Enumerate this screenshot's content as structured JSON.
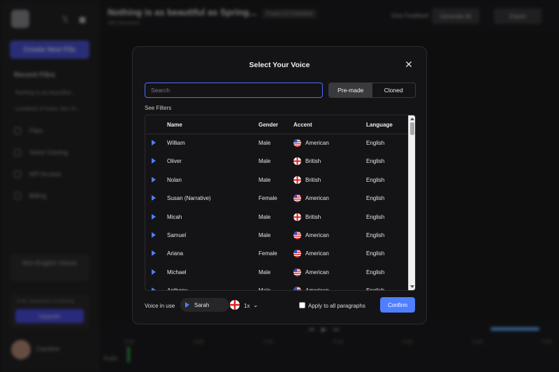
{
  "app": {
    "window_title": "Nothing is as beautiful as Spring...",
    "doc_badge": "Fixed (10 Editable)",
    "doc_sub": "185 characters",
    "create_button": "Create New File",
    "recent_files_label": "Recent Files",
    "recent_files": [
      "Nothing is as beautiful...",
      "Loveliest of trees, the ch..."
    ],
    "nav_items": [
      "Files",
      "Voice Cloning",
      "API Access",
      "Billing"
    ],
    "non_english": "Non-English Voices",
    "chars_remaining": "6.9K characters remaining",
    "upgrade_button": "Upgrade",
    "user_name": "Caroline",
    "feedback_link": "Give Feedback",
    "generate_button": "Generate All",
    "export_button": "Export",
    "timeline_ticks": [
      "0:00",
      "0:05",
      "0:10",
      "0:15",
      "0:20",
      "0:25",
      "0:30"
    ],
    "timeline_track": "Audio"
  },
  "modal": {
    "title": "Select Your Voice",
    "search_placeholder": "Search",
    "tabs": [
      {
        "label": "Pre-made",
        "active": true
      },
      {
        "label": "Cloned",
        "active": false
      }
    ],
    "see_filters": "See Filters",
    "columns": {
      "name": "Name",
      "gender": "Gender",
      "accent": "Accent",
      "language": "Language"
    },
    "voices": [
      {
        "name": "William",
        "gender": "Male",
        "accent": "American",
        "flag": "us-flag-icon",
        "language": "English"
      },
      {
        "name": "Oliver",
        "gender": "Male",
        "accent": "British",
        "flag": "uk-flag-icon",
        "language": "English"
      },
      {
        "name": "Nolan",
        "gender": "Male",
        "accent": "British",
        "flag": "uk-flag-icon",
        "language": "English"
      },
      {
        "name": "Susan (Narrative)",
        "gender": "Female",
        "accent": "American",
        "flag": "us-flag-icon",
        "language": "English"
      },
      {
        "name": "Micah",
        "gender": "Male",
        "accent": "British",
        "flag": "uk-flag-icon",
        "language": "English"
      },
      {
        "name": "Samuel",
        "gender": "Male",
        "accent": "American",
        "flag": "us-flag-icon",
        "language": "English"
      },
      {
        "name": "Ariana",
        "gender": "Female",
        "accent": "American",
        "flag": "us-flag-icon",
        "language": "English"
      },
      {
        "name": "Michael",
        "gender": "Male",
        "accent": "American",
        "flag": "us-flag-icon",
        "language": "English"
      },
      {
        "name": "Anthony",
        "gender": "Male",
        "accent": "American",
        "flag": "us-flag-icon",
        "language": "English"
      }
    ],
    "footer": {
      "voice_in_use_label": "Voice in use",
      "current_voice": "Sarah",
      "current_flag": "uk-flag-icon",
      "speed": "1x",
      "apply_all_label": "Apply to all paragraphs",
      "apply_all_checked": false,
      "confirm_button": "Confirm"
    }
  },
  "colors": {
    "accent_blue": "#4f7fff",
    "modal_bg": "#141416",
    "search_focus_border": "#4f6dff"
  }
}
